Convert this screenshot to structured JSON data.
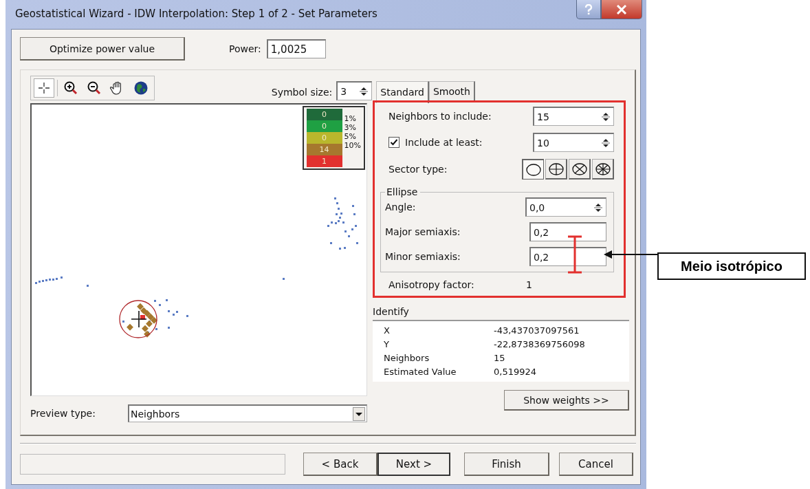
{
  "window": {
    "title": "Geostatistical Wizard - IDW Interpolation: Step 1 of 2 - Set Parameters"
  },
  "optimize_button": "Optimize power value",
  "power": {
    "label": "Power:",
    "value": "1,0025"
  },
  "toolbar_tools": [
    {
      "kind": "identify",
      "selected": true
    },
    {
      "kind": "zoom-in",
      "selected": false
    },
    {
      "kind": "zoom-out",
      "selected": false
    },
    {
      "kind": "pan",
      "selected": false
    },
    {
      "kind": "full-extent",
      "selected": false
    }
  ],
  "symbol_size": {
    "label": "Symbol size:",
    "value": "3"
  },
  "tabs": [
    {
      "label": "Standard",
      "selected": true
    },
    {
      "label": "Smooth",
      "selected": false
    }
  ],
  "legend": [
    {
      "count": "0",
      "color": "#1f6a3a",
      "percent": "1%"
    },
    {
      "count": "0",
      "color": "#1fa043",
      "percent": "3%"
    },
    {
      "count": "0",
      "color": "#b9b72c",
      "percent": "5%"
    },
    {
      "count": "14",
      "color": "#a6782e",
      "percent": "10%"
    },
    {
      "count": "1",
      "color": "#e2302e"
    }
  ],
  "neighbors": {
    "label": "Neighbors to include:",
    "value": "15"
  },
  "include_at_least": {
    "label": "Include at least:",
    "checked": true,
    "value": "10"
  },
  "sector_type": {
    "label": "Sector type:",
    "options": [
      {
        "kind": "one",
        "selected": true
      },
      {
        "kind": "four",
        "selected": false
      },
      {
        "kind": "four-45",
        "selected": false
      },
      {
        "kind": "eight",
        "selected": false
      }
    ]
  },
  "ellipse": {
    "title": "Ellipse",
    "angle": {
      "label": "Angle:",
      "value": "0,0"
    },
    "major": {
      "label": "Major semiaxis:",
      "value": "0,2"
    },
    "minor": {
      "label": "Minor semiaxis:",
      "value": "0,2"
    }
  },
  "anisotropy": {
    "label": "Anisotropy factor:",
    "value": "1"
  },
  "identify": {
    "title": "Identify",
    "rows": [
      {
        "name": "X",
        "value": "-43,437037097561"
      },
      {
        "name": "Y",
        "value": "-22,8738369756098"
      },
      {
        "name": "Neighbors",
        "value": "15"
      },
      {
        "name": "Estimated Value",
        "value": "0,519924"
      }
    ]
  },
  "preview_type": {
    "label": "Preview type:",
    "value": "Neighbors"
  },
  "show_weights_button": "Show weights >>",
  "nav_buttons": [
    {
      "label": "< Back",
      "focused": false
    },
    {
      "label": "Next >",
      "focused": true
    },
    {
      "label": "Finish",
      "focused": false
    },
    {
      "label": "Cancel",
      "focused": false
    }
  ],
  "annotation": "Meio isotrópico"
}
